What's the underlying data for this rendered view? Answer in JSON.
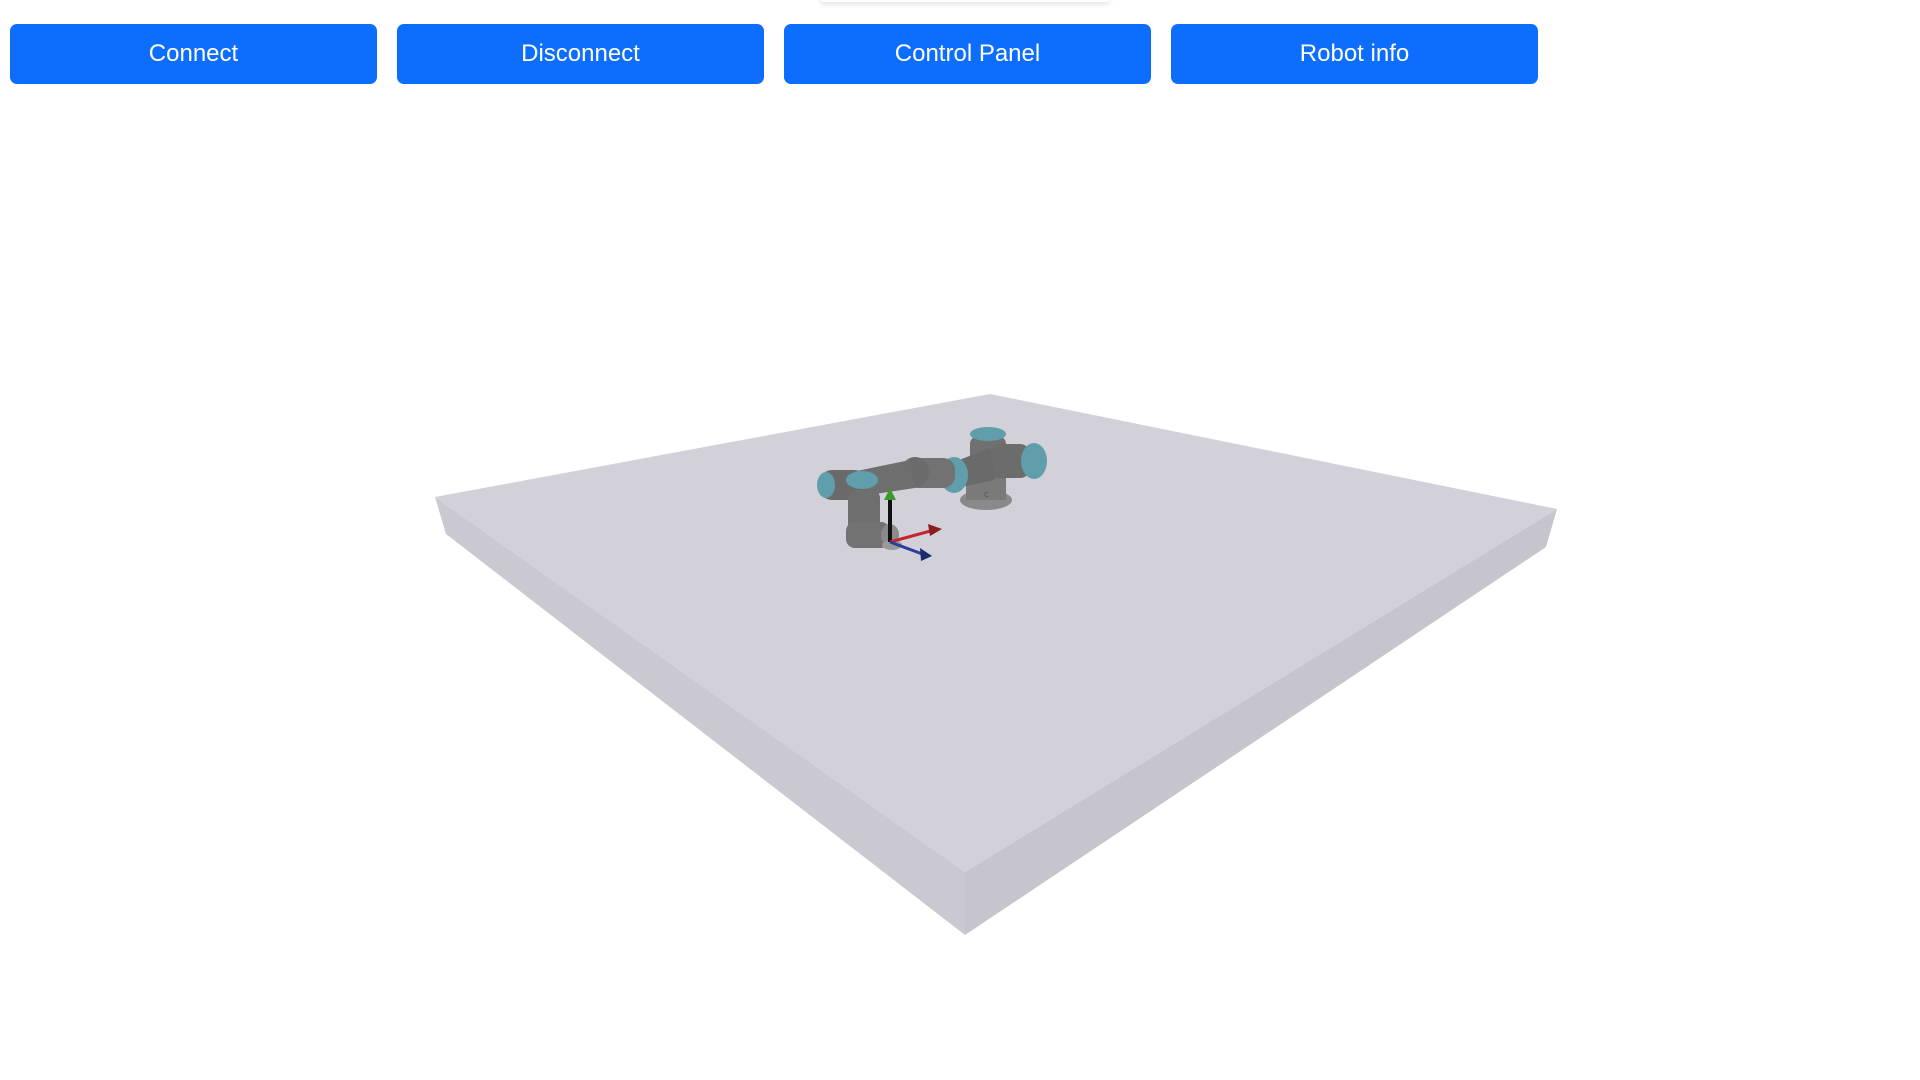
{
  "toolbar": {
    "buttons": [
      {
        "label": "Connect"
      },
      {
        "label": "Disconnect"
      },
      {
        "label": "Control Panel"
      },
      {
        "label": "Robot info"
      }
    ],
    "accent_color": "#0d6efd"
  },
  "scene": {
    "floor_color": "#d2d1da",
    "floor_side_color": "#c8c7cf",
    "robot_body_color": "#707070",
    "robot_joint_color": "#5f9eaa",
    "axis_colors": {
      "x": "#c0272d",
      "y": "#3a9b2a",
      "z": "#2a3f9b"
    }
  }
}
